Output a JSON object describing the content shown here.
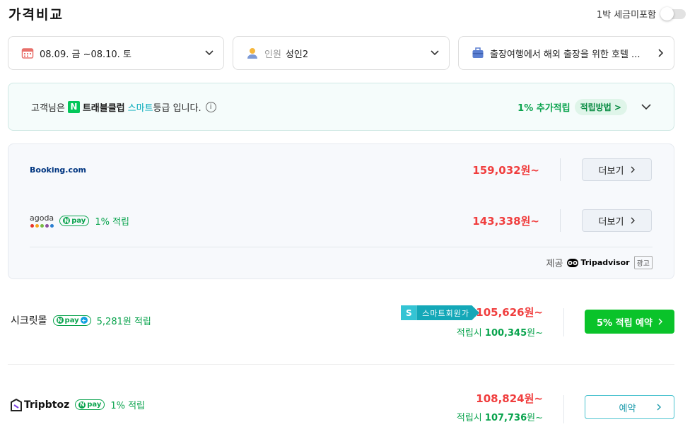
{
  "header": {
    "title": "가격비교",
    "tax_toggle_label": "1박 세금미포함"
  },
  "filters": {
    "dates": "08.09. 금 ~08.10. 토",
    "guests_label": "인원",
    "guests_value": "성인2",
    "trip_purpose": "출장여행에서 해외 출장을 위한 호텔 ..."
  },
  "membership": {
    "prefix": "고객님은",
    "club_badge": "N",
    "club_name": "트래블클럽",
    "grade": "스마트",
    "suffix": "등급 입니다.",
    "info_icon": "i",
    "extra_accrual": "1% 추가적립",
    "how_button": "적립방법 >"
  },
  "partners": {
    "booking": {
      "logo": "Booking.com",
      "price": "159,032원~",
      "more": "더보기"
    },
    "agoda": {
      "logo": "agoda",
      "pay_badge": "pay",
      "accrual": "1% 적립",
      "price": "143,338원~",
      "more": "더보기"
    },
    "provider_prefix": "제공",
    "provider_name": "Tripadvisor",
    "ad_label": "광고"
  },
  "deals": [
    {
      "name": "시크릿몰",
      "pay_badge": "pay",
      "accrual": "5,281원 적립",
      "smart_s": "S",
      "smart_label": "스마트회원가",
      "price": "105,626원~",
      "accrual_prefix": "적립시",
      "accrual_price": "100,345",
      "accrual_suffix": "원~",
      "button": "5% 적립 예약"
    },
    {
      "name": "Tripbtoz",
      "pay_badge": "pay",
      "accrual": "1% 적립",
      "price": "108,824원~",
      "accrual_prefix": "적립시",
      "accrual_price": "107,736",
      "accrual_suffix": "원~",
      "button": "예약"
    }
  ],
  "icons": {
    "chevron_down": "⌄",
    "chevron_right": "›",
    "calendar": "calendar-icon",
    "person": "person-icon",
    "briefcase": "briefcase-icon"
  }
}
